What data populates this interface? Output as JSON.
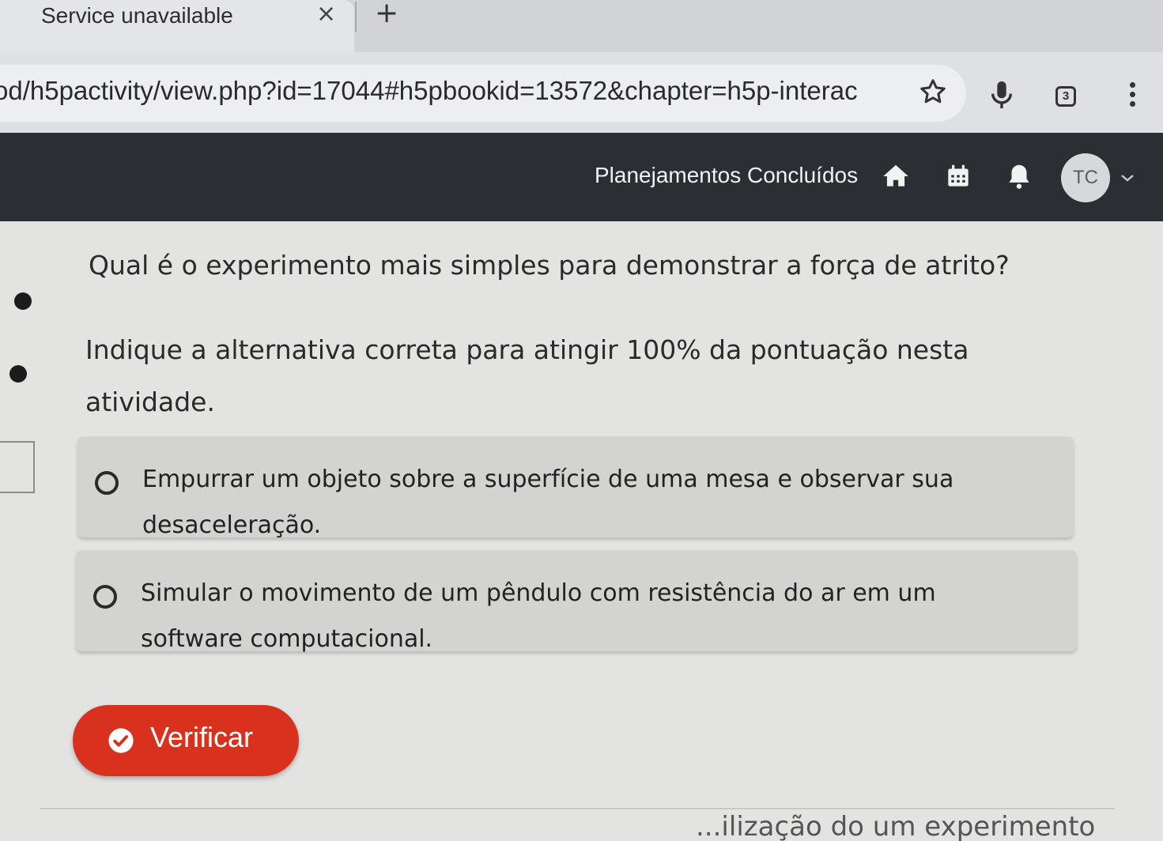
{
  "browser": {
    "tab_title": "Service unavailable",
    "tab_close": "×",
    "new_tab": "+",
    "url": "od/h5pactivity/view.php?id=17044#h5pbookid=13572&chapter=h5p-interac",
    "tab_count": "3"
  },
  "site_nav": {
    "title": "Planejamentos Concluídos",
    "avatar_initials": "TC"
  },
  "activity": {
    "question": "Qual é o experimento mais simples para demonstrar a força de atrito?",
    "instruction": "Indique a alternativa correta para atingir 100% da pontuação nesta atividade.",
    "options": [
      {
        "label": "Empurrar um objeto sobre a superfície de uma mesa e observar sua desaceleração.",
        "selected": false
      },
      {
        "label": "Simular o movimento de um pêndulo com resistência do ar em um software computacional.",
        "selected": false
      }
    ],
    "verify_label": "Verificar",
    "footer_partial": "...ilização do um experimento"
  },
  "colors": {
    "nav_bg": "#2b2f33",
    "verify_button": "#d8321f",
    "option_bg": "#d3d3d1"
  },
  "icons": [
    "star-icon",
    "mic-icon",
    "menu-icon",
    "home-icon",
    "calendar-icon",
    "bell-icon",
    "chevron-down-icon",
    "check-icon"
  ]
}
